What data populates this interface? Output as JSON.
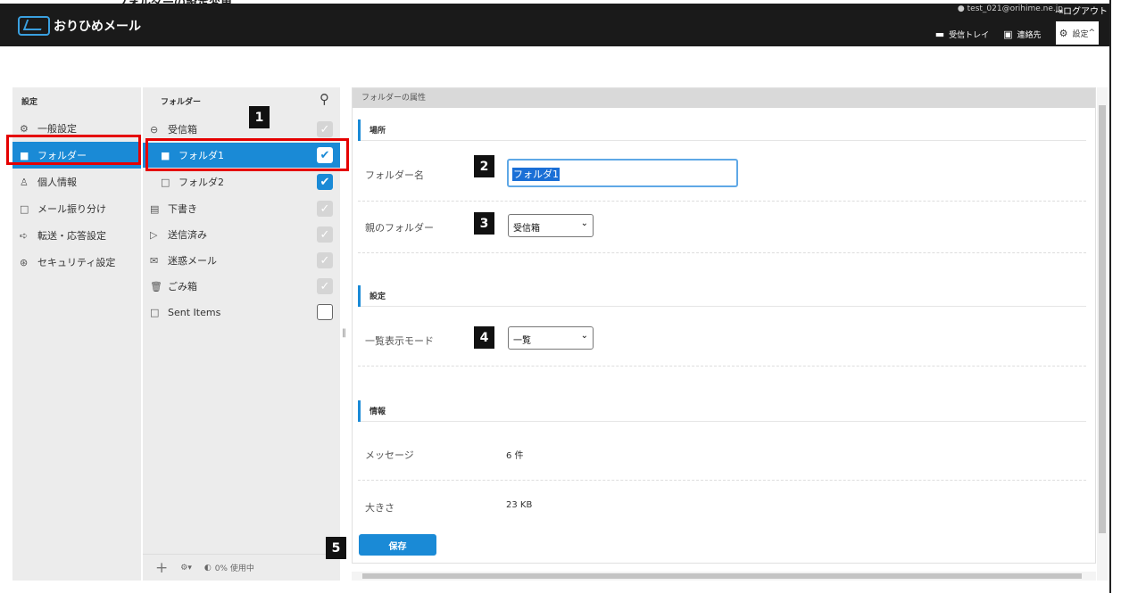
{
  "header": {
    "cut_title": "フォルダーの設定変更",
    "logo_text": "おりひめメール",
    "user_email": "test_021@orihime.ne.jp",
    "logout_label": "ログアウト",
    "nav": [
      {
        "label": "受信トレイ",
        "icon": "inbox-icon"
      },
      {
        "label": "連絡先",
        "icon": "contacts-icon"
      },
      {
        "label": "設定",
        "icon": "gear-icon"
      }
    ]
  },
  "settings_menu": {
    "title": "設定",
    "items": [
      {
        "label": "一般設定",
        "icon": "gear-icon"
      },
      {
        "label": "フォルダー",
        "icon": "folder-icon",
        "selected": true
      },
      {
        "label": "個人情報",
        "icon": "person-icon"
      },
      {
        "label": "メール振り分け",
        "icon": "folder-outline-icon"
      },
      {
        "label": "転送・応答設定",
        "icon": "forward-icon"
      },
      {
        "label": "セキュリティ設定",
        "icon": "security-icon"
      }
    ]
  },
  "folders": {
    "title": "フォルダー",
    "items": [
      {
        "label": "受信箱",
        "icon": "inbox-icon",
        "check": "disabled"
      },
      {
        "label": "フォルダ1",
        "icon": "folder-icon",
        "check": "selected",
        "selected": true
      },
      {
        "label": "フォルダ2",
        "icon": "folder-outline-icon",
        "check": "on"
      },
      {
        "label": "下書き",
        "icon": "draft-icon",
        "check": "disabled"
      },
      {
        "label": "送信済み",
        "icon": "send-icon",
        "check": "disabled"
      },
      {
        "label": "迷惑メール",
        "icon": "spam-icon",
        "check": "disabled"
      },
      {
        "label": "ごみ箱",
        "icon": "trash-icon",
        "check": "disabled"
      },
      {
        "label": "Sent Items",
        "icon": "folder-outline-icon",
        "check": "off"
      }
    ],
    "usage": "0% 使用中"
  },
  "props": {
    "header": "フォルダーの属性",
    "section_location": "場所",
    "folder_name_label": "フォルダー名",
    "folder_name_value": "フォルダ1",
    "parent_label": "親のフォルダー",
    "parent_value": "受信箱",
    "section_settings": "設定",
    "view_mode_label": "一覧表示モード",
    "view_mode_value": "一覧",
    "section_info": "情報",
    "messages_label": "メッセージ",
    "messages_value": "6 件",
    "size_label": "大きさ",
    "size_value": "23 KB",
    "save_label": "保存"
  },
  "badges": [
    "1",
    "2",
    "3",
    "4",
    "5"
  ],
  "colors": {
    "accent": "#1a8ad6",
    "highlight": "#e50000"
  }
}
